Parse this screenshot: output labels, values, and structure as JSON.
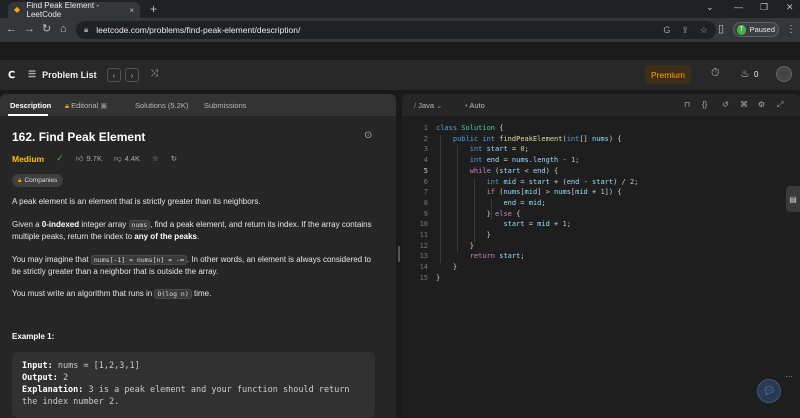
{
  "browser": {
    "tab_title": "Find Peak Element - LeetCode",
    "tab_close": "×",
    "new_tab": "+",
    "url": "leetcode.com/problems/find-peak-element/description/",
    "profile_initial": "T",
    "profile_status": "Paused",
    "icons": [
      "back-arrow-icon",
      "forward-arrow-icon",
      "reload-icon",
      "lock-icon",
      "google-icon",
      "share-icon",
      "star-icon",
      "sidebar-icon",
      "kebab-menu-icon"
    ]
  },
  "header": {
    "problem_list": "Problem List",
    "premium": "Premium",
    "streak_count": "0"
  },
  "left_tabs": {
    "description": "Description",
    "editorial": "Editorial",
    "solutions": "Solutions (5.2K)",
    "submissions": "Submissions"
  },
  "problem": {
    "title": "162. Find Peak Element",
    "difficulty": "Medium",
    "likes": "9.7K",
    "dislikes": "4.4K",
    "companies": "Companies",
    "p1": "A peak element is an element that is strictly greater than its neighbors.",
    "p2_pre": "Given a ",
    "p2_bold": "0-indexed",
    "p2_mid": " integer array ",
    "p2_code": "nums",
    "p2_post": ", find a peak element, and return its index. If the array contains multiple peaks, return the index to ",
    "p2_bold2": "any of the peaks",
    "p2_end": ".",
    "p3_pre": "You may imagine that ",
    "p3_code1": "nums[-1] = nums[n] = -∞",
    "p3_post": ". In other words, an element is always considered to be strictly greater than a neighbor that is outside the array.",
    "p4_pre": "You must write an algorithm that runs in ",
    "p4_code": "O(log n)",
    "p4_post": " time.",
    "example_title": "Example 1:",
    "ex_input_label": "Input:",
    "ex_input": " nums = [1,2,3,1]",
    "ex_output_label": "Output:",
    "ex_output": " 2",
    "ex_expl_label": "Explanation:",
    "ex_expl": " 3 is a peak element and your function should return the index number 2."
  },
  "editor": {
    "language": "Java",
    "mode": "Auto",
    "lines": [
      "1",
      "2",
      "3",
      "4",
      "5",
      "6",
      "7",
      "8",
      "9",
      "10",
      "11",
      "12",
      "13",
      "14",
      "15"
    ]
  }
}
